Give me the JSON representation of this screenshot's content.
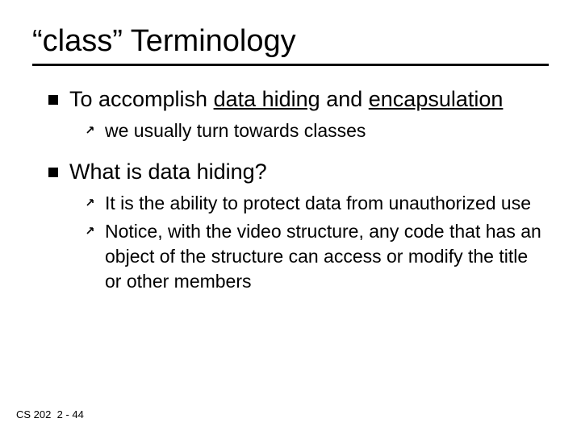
{
  "title": "“class” Terminology",
  "b1": {
    "pre": "To accomplish ",
    "u1": "data hiding",
    "mid": " and ",
    "u2": "encapsulation"
  },
  "b1s1": "we usually turn towards classes",
  "b2": "What is data hiding?",
  "b2s1": "It is the ability to protect data from unauthorized use",
  "b2s2": "Notice, with the video structure, any code that has an object of the structure can access or modify the title or other members",
  "footer": {
    "course": "CS 202",
    "page": "2 - 44"
  }
}
